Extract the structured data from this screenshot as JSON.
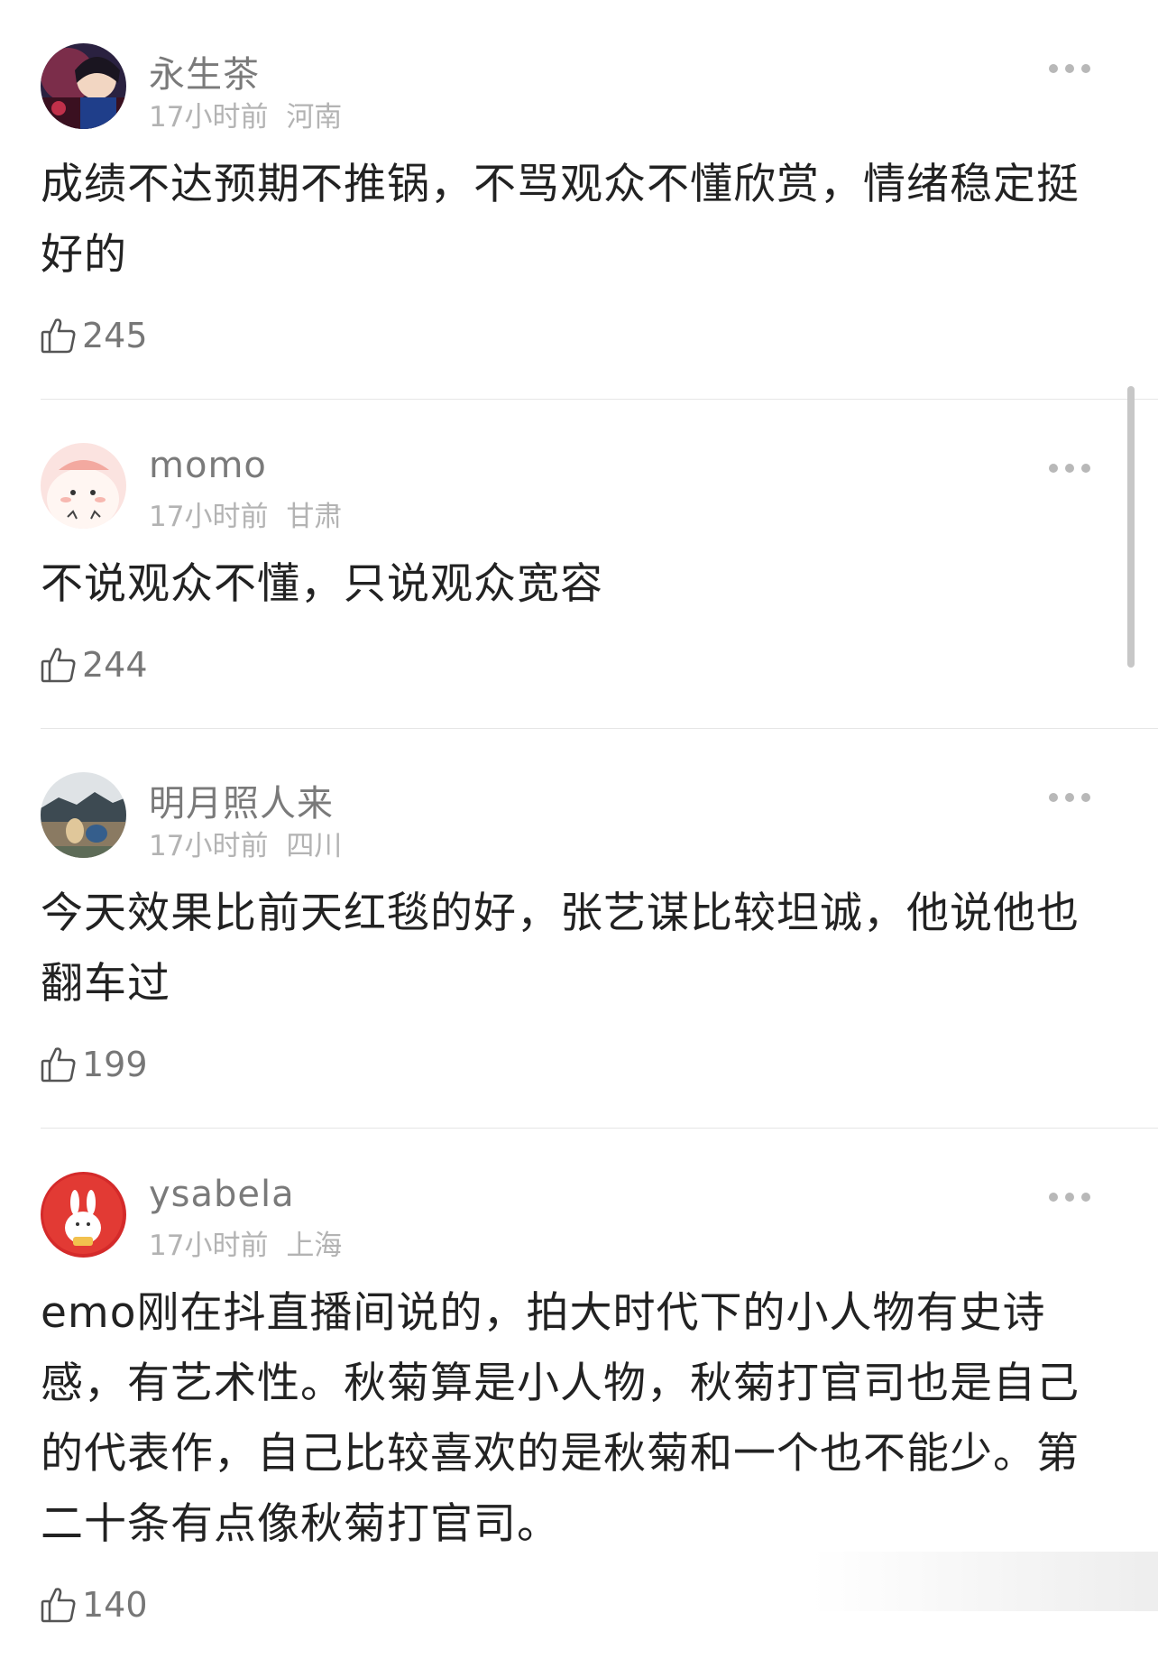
{
  "comments": [
    {
      "username": "永生茶",
      "time": "17小时前",
      "location": "河南",
      "text": "成绩不达预期不推锅，不骂观众不懂欣赏，情绪稳定挺好的",
      "likes": "245"
    },
    {
      "username": "momo",
      "time": "17小时前",
      "location": "甘肃",
      "text": "不说观众不懂，只说观众宽容",
      "likes": "244"
    },
    {
      "username": "明月照人来",
      "time": "17小时前",
      "location": "四川",
      "text": "今天效果比前天红毯的好，张艺谋比较坦诚，他说他也翻车过",
      "likes": "199"
    },
    {
      "username": "ysabela",
      "time": "17小时前",
      "location": "上海",
      "text": "emo刚在抖直播间说的，拍大时代下的小人物有史诗感，有艺术性。秋菊算是小人物，秋菊打官司也是自己的代表作，自己比较喜欢的是秋菊和一个也不能少。第二十条有点像秋菊打官司。",
      "likes": "140"
    }
  ],
  "icons": {
    "like": "thumbs-up-icon",
    "more": "more-dots-icon"
  },
  "colors": {
    "username": "#7a7a7a",
    "meta": "#b3b3b3",
    "text": "#222222",
    "divider": "#e6e6e6"
  }
}
